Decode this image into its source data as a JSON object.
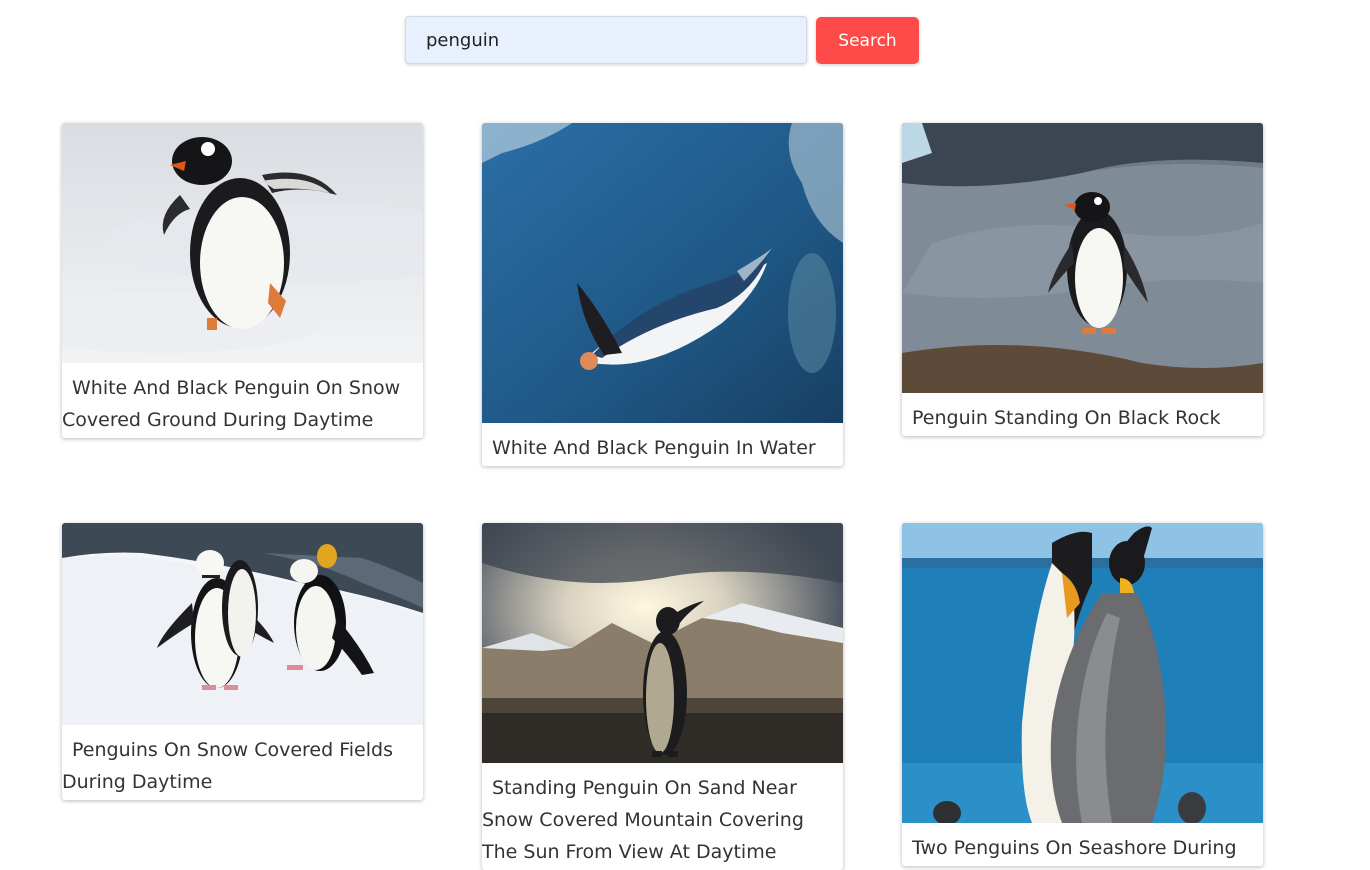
{
  "search": {
    "value": "penguin",
    "placeholder": "",
    "button_label": "Search"
  },
  "results": [
    {
      "title": "White And Black Penguin On Snow Covered Ground During Daytime",
      "image": "penguin-on-snow-image"
    },
    {
      "title": "White And Black Penguin In Water",
      "image": "penguin-swimming-image"
    },
    {
      "title": "Penguin Standing On Black Rock",
      "image": "penguin-on-rock-image"
    },
    {
      "title": "Penguins On Snow Covered Fields During Daytime",
      "image": "penguins-on-snow-field-image"
    },
    {
      "title": "Standing Penguin On Sand Near Snow Covered Mountain Covering The Sun From View At Daytime",
      "image": "penguin-at-sunset-image"
    },
    {
      "title": "Two Penguins On Seashore During",
      "image": "two-king-penguins-image"
    }
  ],
  "colors": {
    "accent": "#ff4a4a",
    "input_bg": "#e8f0fe",
    "text": "#333333"
  }
}
